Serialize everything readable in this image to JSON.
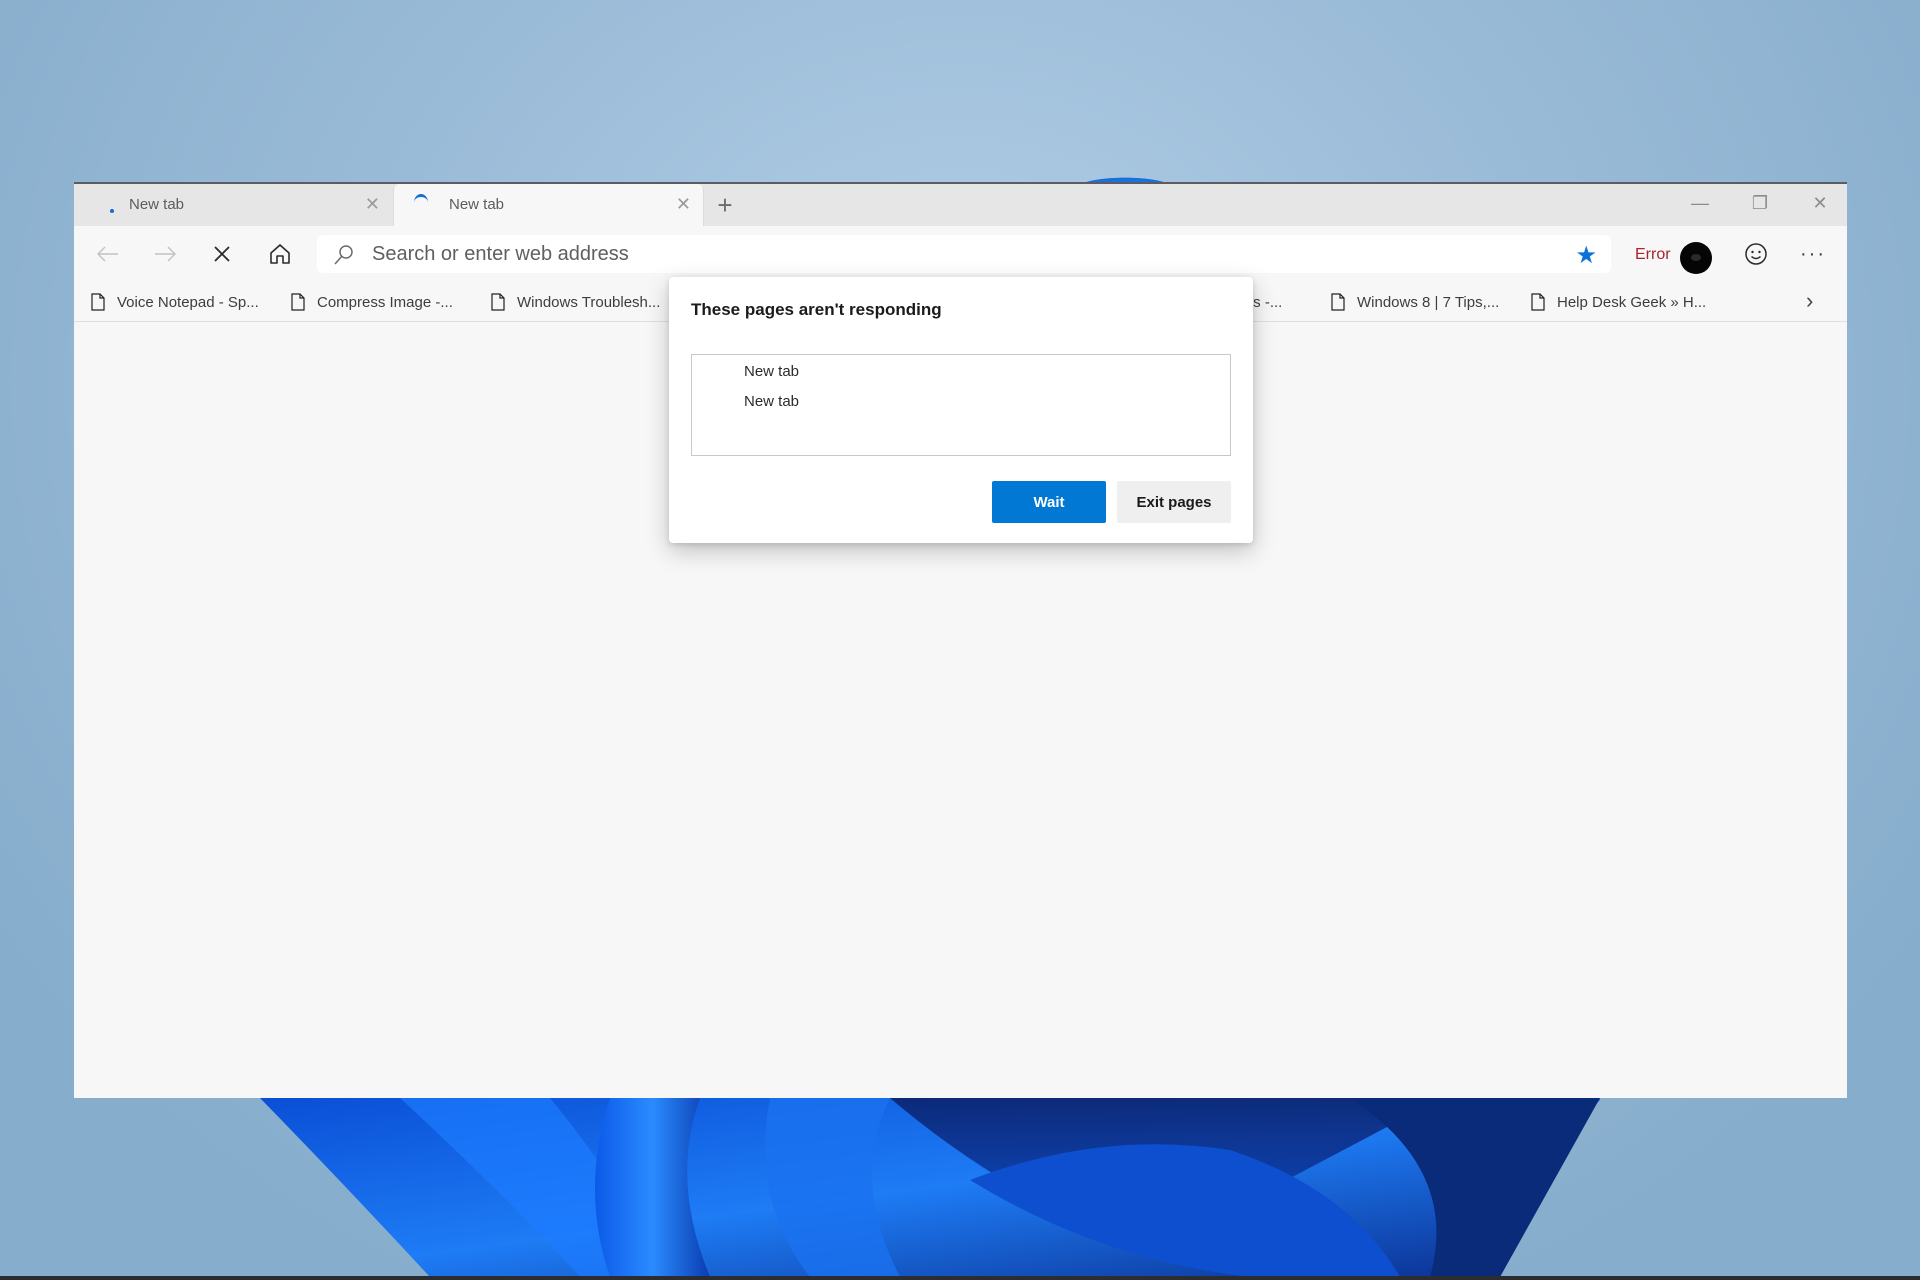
{
  "browser": {
    "tabs": [
      {
        "title": "New tab",
        "state": "inactive",
        "favicon": "loading-dot-icon"
      },
      {
        "title": "New tab",
        "state": "active",
        "favicon": "loading-spinner-icon"
      }
    ],
    "new_tab_symbol": "+",
    "window_controls": {
      "minimize": "—",
      "restore": "❐",
      "close": "✕"
    },
    "toolbar": {
      "back": "←",
      "forward": "→",
      "stop": "✕",
      "address_placeholder": "Search or enter web address",
      "address_value": "",
      "favorite_star": "★",
      "profile_status": "Error",
      "feedback": "☺",
      "more": "···"
    },
    "bookmarks": [
      {
        "label": "Voice Notepad - Sp..."
      },
      {
        "label": "Compress Image -..."
      },
      {
        "label": "Windows Troublesh..."
      },
      {
        "label": "ows -..."
      },
      {
        "label": "Windows 8 | 7 Tips,..."
      },
      {
        "label": "Help Desk Geek » H..."
      }
    ],
    "bookmarks_overflow": "›"
  },
  "dialog": {
    "title": "These pages aren't responding",
    "pages": [
      "New tab",
      "New tab"
    ],
    "wait_label": "Wait",
    "exit_label": "Exit pages"
  },
  "colors": {
    "accent": "#0078d4",
    "error": "#a4262c",
    "star": "#0a72d9"
  }
}
